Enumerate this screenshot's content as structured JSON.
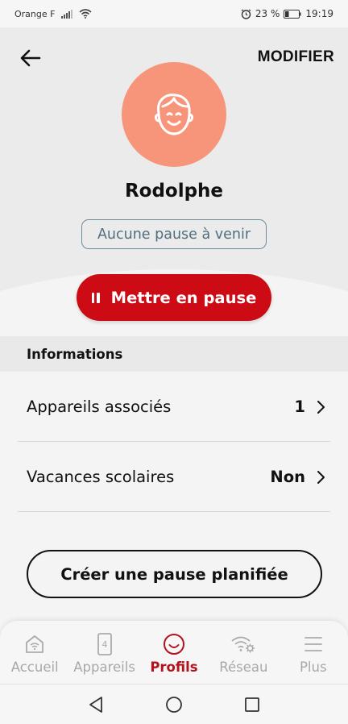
{
  "status_bar": {
    "carrier": "Orange F",
    "battery_percent": "23 %",
    "time": "19:19"
  },
  "header": {
    "edit_label": "MODIFIER",
    "back_icon": "arrow-left-icon"
  },
  "profile": {
    "name": "Rodolphe",
    "pause_status": "Aucune pause à venir",
    "avatar_icon": "boy-face-icon",
    "avatar_color": "#f7957a",
    "pause_button_label": "Mettre en pause"
  },
  "informations": {
    "section_title": "Informations",
    "rows": [
      {
        "label": "Appareils associés",
        "value": "1"
      },
      {
        "label": "Vacances scolaires",
        "value": "Non"
      }
    ]
  },
  "create_pause_label": "Créer une pause planifiée",
  "tabs": [
    {
      "label": "Accueil",
      "icon": "home-wifi-icon",
      "active": false
    },
    {
      "label": "Appareils",
      "icon": "phone-device-icon",
      "badge": "4",
      "active": false
    },
    {
      "label": "Profils",
      "icon": "smile-profile-icon",
      "active": true
    },
    {
      "label": "Réseau",
      "icon": "wifi-settings-icon",
      "active": false
    },
    {
      "label": "Plus",
      "icon": "menu-icon",
      "active": false
    }
  ],
  "colors": {
    "accent_red": "#cc0b14",
    "active_tab": "#b3131c",
    "chip_border": "#6d8c9a"
  }
}
